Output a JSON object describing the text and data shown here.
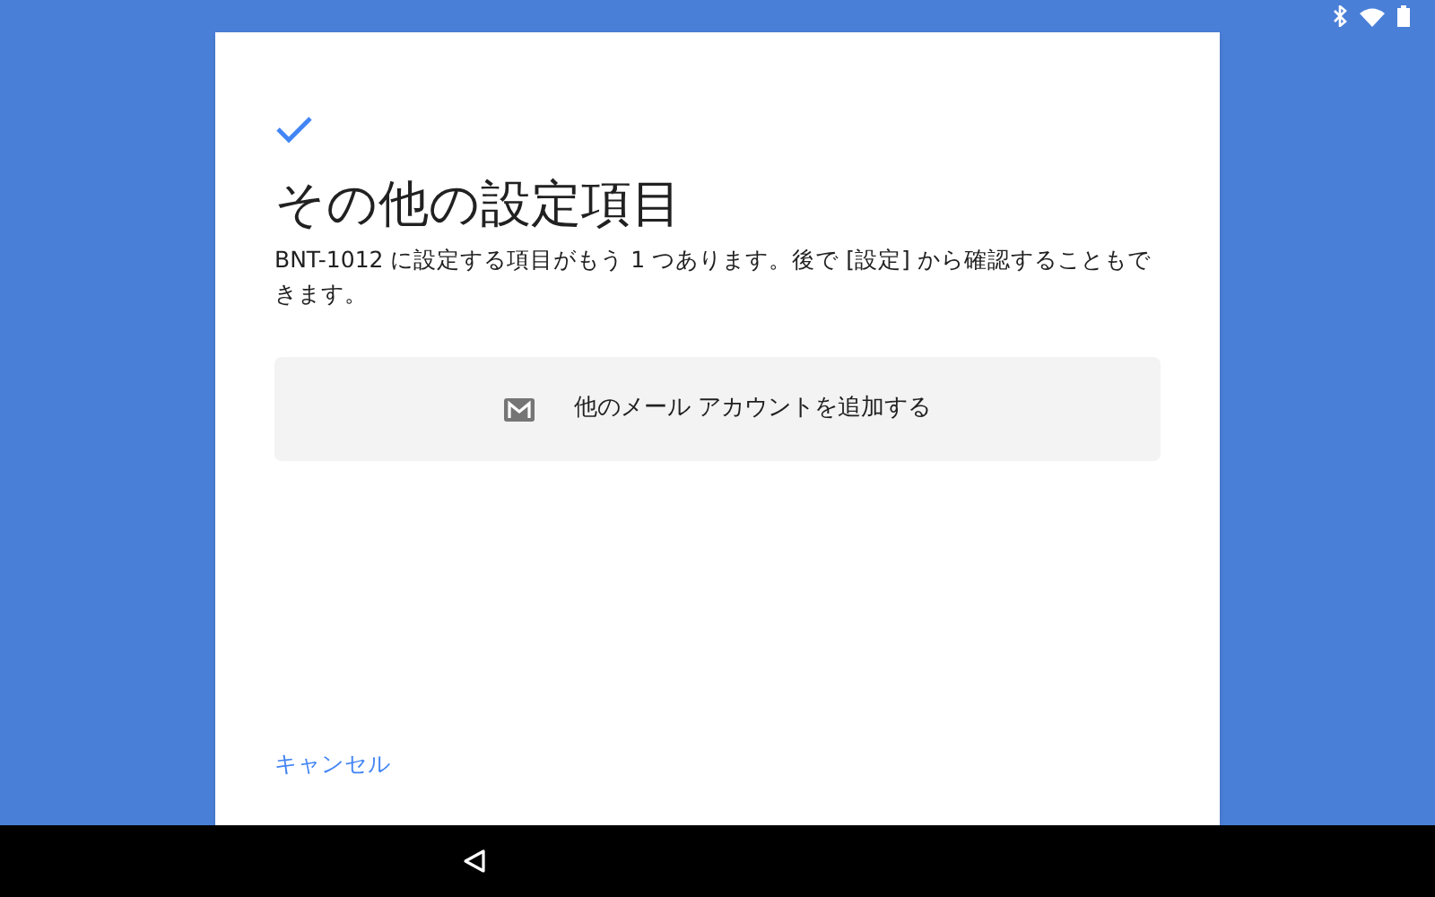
{
  "title": "その他の設定項目",
  "description": "BNT-1012 に設定する項目がもう 1 つあります。後で [設定] から確認することもできます。",
  "options": [
    {
      "label": "他のメール アカウントを追加する"
    }
  ],
  "cancel": "キャンセル"
}
